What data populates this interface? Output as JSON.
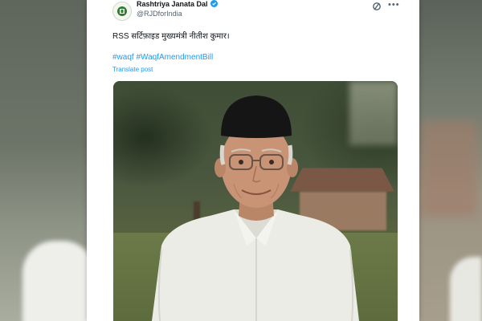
{
  "tweet": {
    "author_name": "Rashtriya Janata Dal",
    "author_handle": "@RJDforIndia",
    "text": "RSS सर्टिफ़ाइड मुख्यमंत्री नीतीश कुमार।",
    "hashtags": [
      "#waqf",
      "#WaqfAmendmentBill"
    ],
    "translate_label": "Translate post",
    "verified": true
  },
  "icons": {
    "verified": "verified-badge-icon",
    "grok": "grok-icon",
    "more": "more-options-icon"
  },
  "colors": {
    "link": "#1d9bf0",
    "text": "#0f1419",
    "secondary": "#536471"
  }
}
